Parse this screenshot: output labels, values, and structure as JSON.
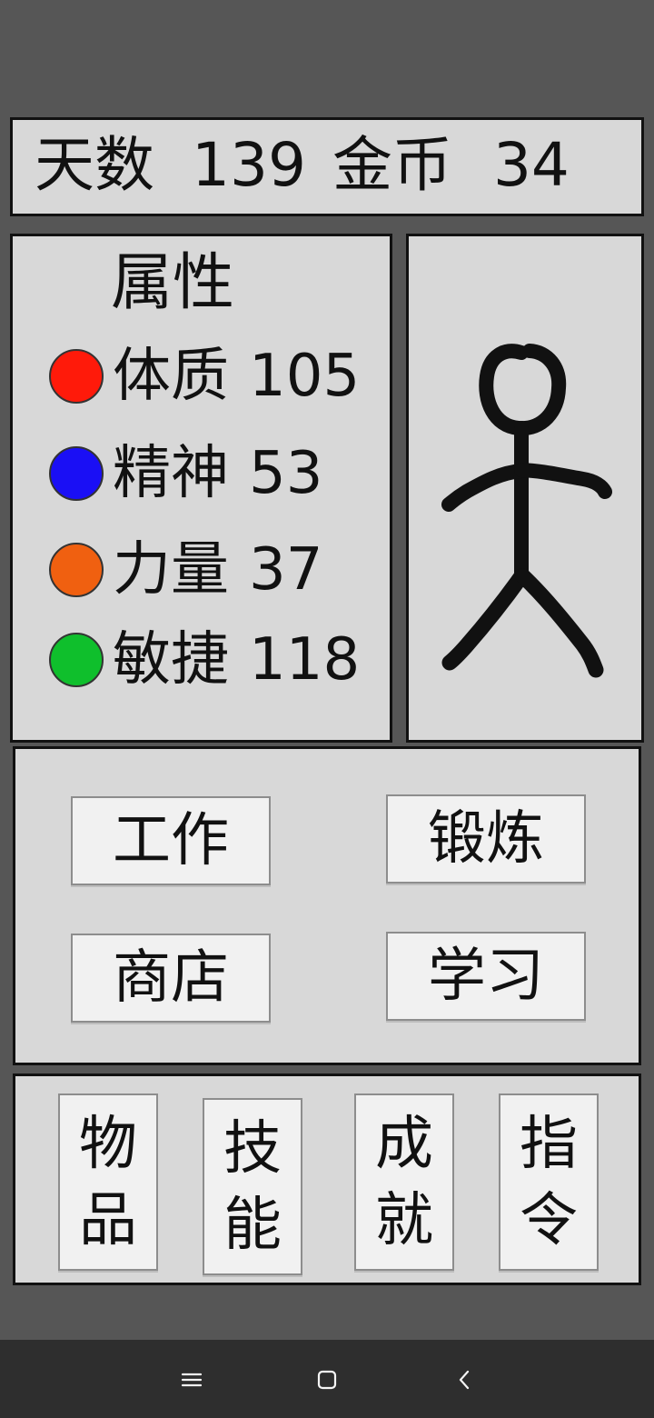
{
  "status_bar": {
    "days_label": "天数",
    "days_value": "139",
    "gold_label": "金币",
    "gold_value": "34"
  },
  "attributes": {
    "title": "属性",
    "items": [
      {
        "label": "体质",
        "value": "105",
        "color": "#ff1a0a",
        "icon": "red-circle"
      },
      {
        "label": "精神",
        "value": "53",
        "color": "#1a0ff5",
        "icon": "blue-circle"
      },
      {
        "label": "力量",
        "value": "37",
        "color": "#f06010",
        "icon": "orange-circle"
      },
      {
        "label": "敏捷",
        "value": "118",
        "color": "#0fbf2c",
        "icon": "green-circle"
      }
    ]
  },
  "character": {
    "icon": "stick-figure"
  },
  "actions": {
    "work": "工作",
    "train": "锻炼",
    "shop": "商店",
    "study": "学习"
  },
  "tabs": {
    "items": "物品",
    "skills": "技能",
    "achievements": "成就",
    "commands": "指令"
  },
  "navigation": {
    "menu_icon": "menu-icon",
    "home_icon": "home-icon",
    "back_icon": "back-icon"
  }
}
